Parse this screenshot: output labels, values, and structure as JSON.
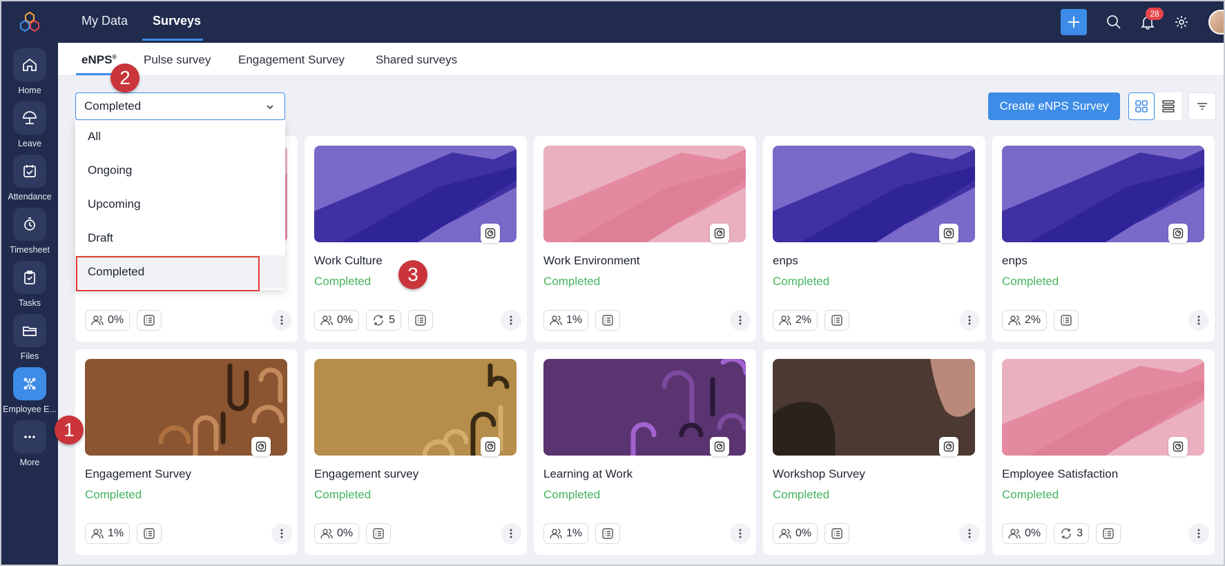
{
  "nav": {
    "items": [
      {
        "label": "Home",
        "icon": "home-icon"
      },
      {
        "label": "Leave",
        "icon": "umbrella-icon"
      },
      {
        "label": "Attendance",
        "icon": "calendar-check-icon"
      },
      {
        "label": "Timesheet",
        "icon": "stopwatch-icon"
      },
      {
        "label": "Tasks",
        "icon": "clipboard-check-icon"
      },
      {
        "label": "Files",
        "icon": "folder-icon"
      },
      {
        "label": "Employee E...",
        "icon": "engagement-icon"
      },
      {
        "label": "More",
        "icon": "more-horizontal-icon"
      }
    ]
  },
  "topbar": {
    "tabs": [
      "My Data",
      "Surveys"
    ],
    "notification_count": "28"
  },
  "subtabs": {
    "enps": "eNPS",
    "enps_mark": "®",
    "pulse": "Pulse survey",
    "engagement": "Engagement Survey",
    "shared": "Shared surveys"
  },
  "filter": {
    "selected": "Completed",
    "options": [
      "All",
      "Ongoing",
      "Upcoming",
      "Draft",
      "Completed"
    ]
  },
  "actions": {
    "create": "Create eNPS Survey"
  },
  "cards": [
    {
      "title": "",
      "status": "",
      "participation": "0%",
      "cycles": ""
    },
    {
      "title": "Work Culture",
      "status": "Completed",
      "participation": "0%",
      "cycles": "5"
    },
    {
      "title": "Work Environment",
      "status": "Completed",
      "participation": "1%",
      "cycles": ""
    },
    {
      "title": "enps",
      "status": "Completed",
      "participation": "2%",
      "cycles": ""
    },
    {
      "title": "enps",
      "status": "Completed",
      "participation": "2%",
      "cycles": ""
    },
    {
      "title": "Engagement Survey",
      "status": "Completed",
      "participation": "1%",
      "cycles": ""
    },
    {
      "title": "Engagement survey",
      "status": "Completed",
      "participation": "0%",
      "cycles": ""
    },
    {
      "title": "Learning at Work",
      "status": "Completed",
      "participation": "1%",
      "cycles": ""
    },
    {
      "title": "Workshop Survey",
      "status": "Completed",
      "participation": "0%",
      "cycles": ""
    },
    {
      "title": "Employee Satisfaction",
      "status": "Completed",
      "participation": "0%",
      "cycles": "3"
    }
  ],
  "markers": [
    "1",
    "2",
    "3"
  ],
  "colors": {
    "sidebar": "#202b4d",
    "accent": "#3d8ce8",
    "status_completed": "#44b35e",
    "marker": "#c9353a"
  }
}
